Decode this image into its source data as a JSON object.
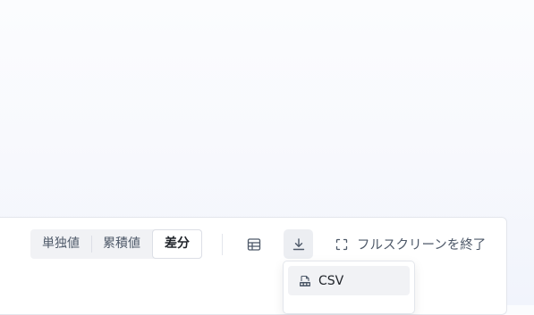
{
  "mode_segment": {
    "options": [
      {
        "label": "単独値",
        "active": false
      },
      {
        "label": "累積値",
        "active": false
      },
      {
        "label": "差分",
        "active": true
      }
    ]
  },
  "toolbar": {
    "table_icon": "table-icon",
    "download_icon": "download-icon",
    "fullscreen_icon": "fullscreen-exit-icon",
    "fullscreen_label": "フルスクリーンを終了"
  },
  "download_menu": {
    "items": [
      {
        "label": "CSV",
        "icon": "csv-file-icon"
      }
    ]
  },
  "colors": {
    "accent_text": "#1f2329",
    "muted_text": "#4e5969",
    "border": "#e3e6ec",
    "hover_bg": "#eceef2"
  }
}
